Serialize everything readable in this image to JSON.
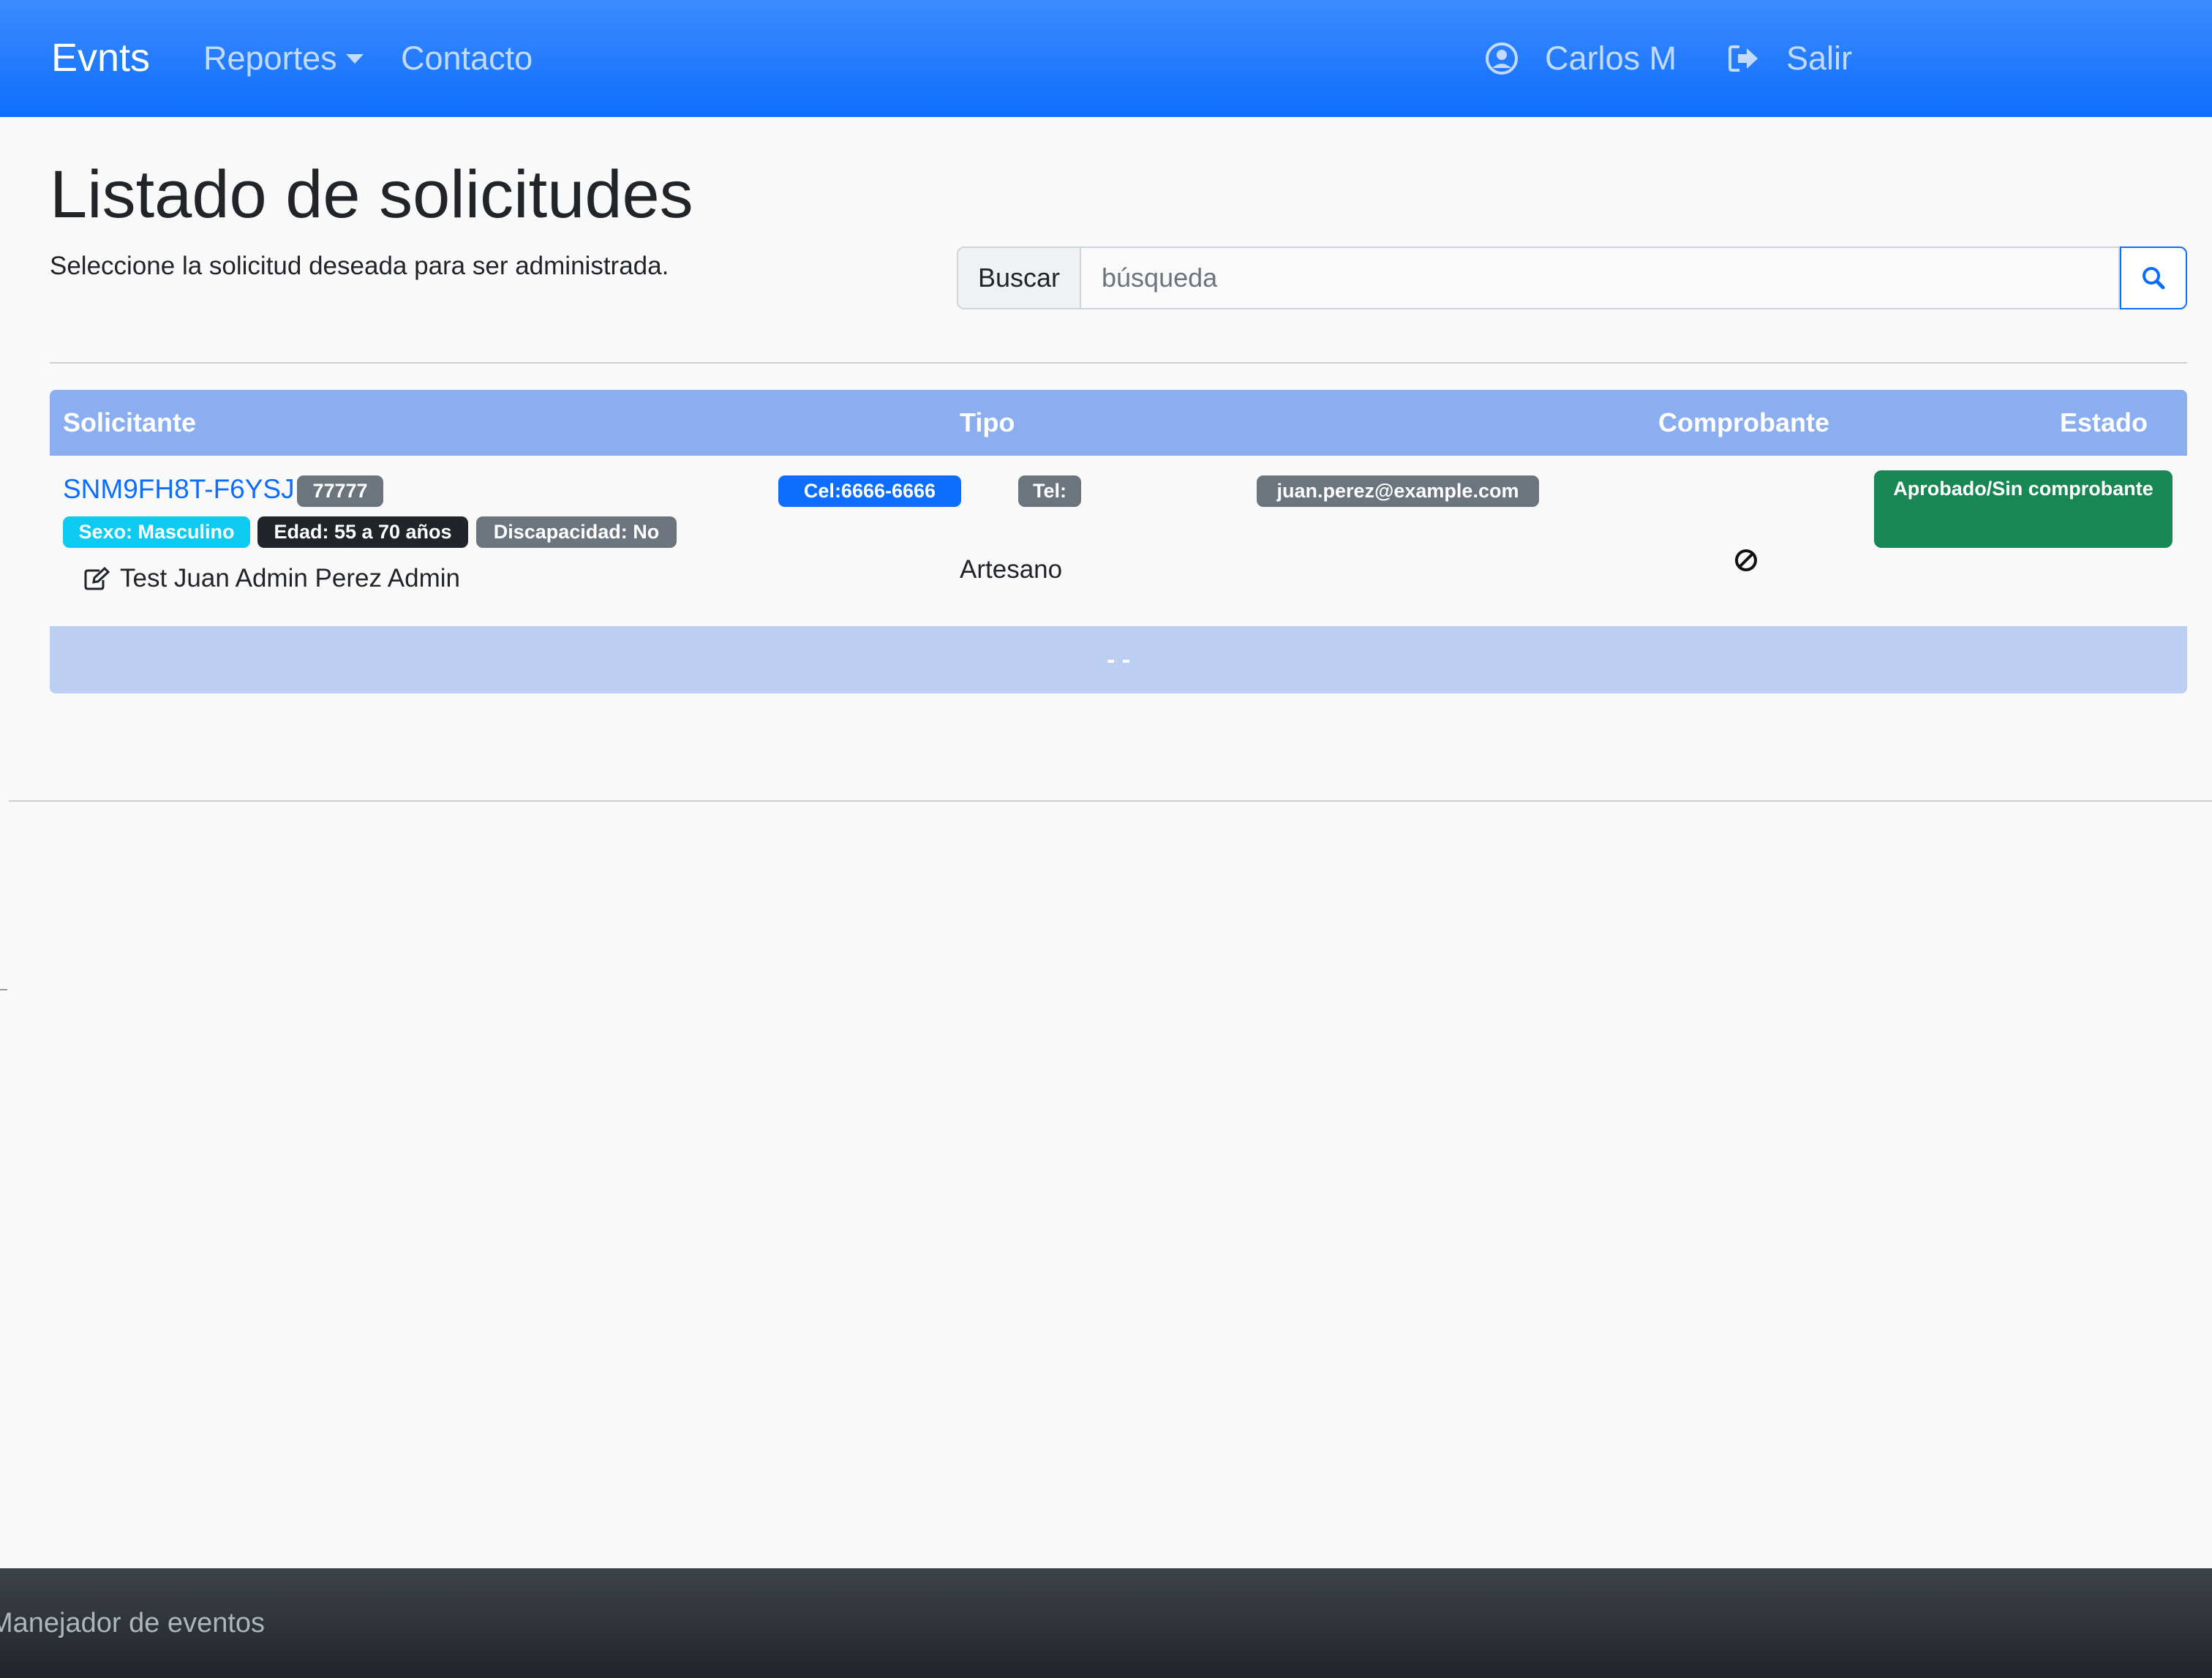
{
  "navbar": {
    "brand": "Evnts",
    "reportes": "Reportes",
    "contacto": "Contacto",
    "user": "Carlos M",
    "logout": "Salir",
    "color": "#0d6efd"
  },
  "page": {
    "title": "Listado de solicitudes",
    "subtitle": "Seleccione la solicitud deseada para ser administrada."
  },
  "search": {
    "label": "Buscar",
    "placeholder": "búsqueda",
    "button_icon": "search-icon"
  },
  "table": {
    "headers": {
      "solicitante": "Solicitante",
      "tipo": "Tipo",
      "comprobante": "Comprobante",
      "estado": "Estado"
    },
    "rows": [
      {
        "folio": "SNM9FH8T-F6YSJ",
        "code": "77777",
        "sexo": "Sexo: Masculino",
        "edad": "Edad: 55 a 70 años",
        "discapacidad": "Discapacidad: No",
        "nombre": "Test Juan Admin Perez Admin",
        "cel": "Cel:6666-6666",
        "tel": "Tel:",
        "email": "juan.perez@example.com",
        "tipo": "Artesano",
        "comprobante_icon": "ban-icon",
        "estado": "Aprobado/Sin comprobante",
        "estado_color": "#198754"
      }
    ],
    "footer": "-  -"
  },
  "footer": {
    "text": "Manejador de eventos"
  }
}
